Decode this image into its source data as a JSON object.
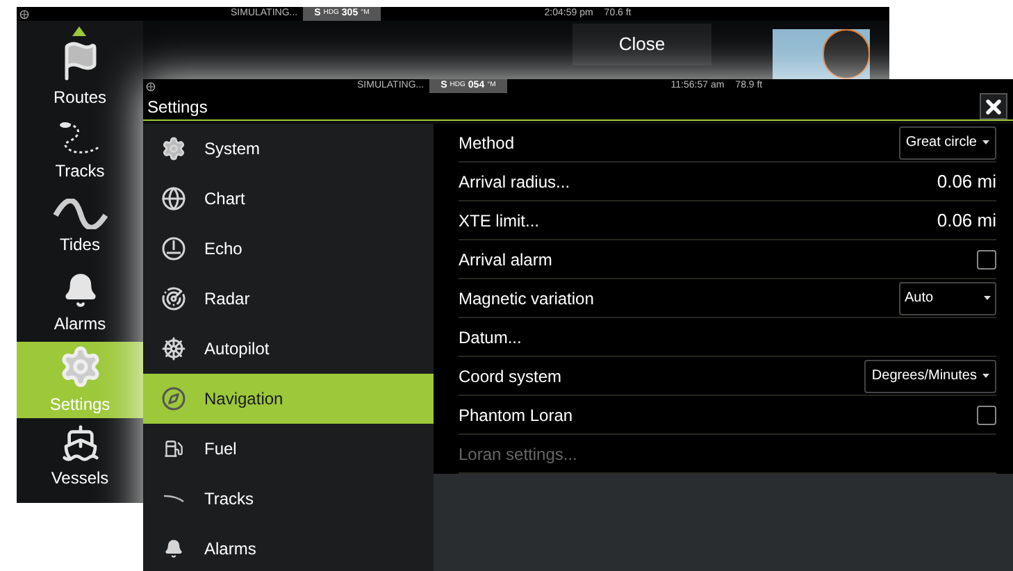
{
  "back_window": {
    "status_bar": {
      "status": "SIMULATING...",
      "heading": [
        "S",
        "HDG",
        "305",
        "°M"
      ],
      "time": "2:04:59 pm",
      "depth": "70.6 ft"
    },
    "close_button": "Close",
    "sidebar": [
      {
        "label": "Routes",
        "selected": false
      },
      {
        "label": "Tracks",
        "selected": false
      },
      {
        "label": "Tides",
        "selected": false
      },
      {
        "label": "Alarms",
        "selected": false
      },
      {
        "label": "Settings",
        "selected": true
      },
      {
        "label": "Vessels",
        "selected": false
      }
    ]
  },
  "settings_window": {
    "status_bar": {
      "status": "SIMULATING...",
      "heading": [
        "S",
        "HDG",
        "054",
        "°M"
      ],
      "time": "11:56:57 am",
      "depth": "78.9 ft"
    },
    "title": "Settings",
    "categories": [
      {
        "label": "System",
        "selected": false
      },
      {
        "label": "Chart",
        "selected": false
      },
      {
        "label": "Echo",
        "selected": false
      },
      {
        "label": "Radar",
        "selected": false
      },
      {
        "label": "Autopilot",
        "selected": false
      },
      {
        "label": "Navigation",
        "selected": true
      },
      {
        "label": "Fuel",
        "selected": false
      },
      {
        "label": "Tracks",
        "selected": false
      },
      {
        "label": "Alarms",
        "selected": false
      }
    ],
    "options": [
      {
        "kind": "dropdown",
        "label": "Method",
        "value": "Great circle"
      },
      {
        "kind": "value",
        "label": "Arrival radius...",
        "value": "0.06 mi"
      },
      {
        "kind": "value",
        "label": "XTE limit...",
        "value": "0.06 mi"
      },
      {
        "kind": "checkbox",
        "label": "Arrival alarm",
        "checked": false
      },
      {
        "kind": "wide-dropdown",
        "label": "Magnetic variation",
        "value": "Auto"
      },
      {
        "kind": "plain",
        "label": "Datum..."
      },
      {
        "kind": "dropdown",
        "label": "Coord system",
        "value": "Degrees/Minutes"
      },
      {
        "kind": "checkbox",
        "label": "Phantom Loran",
        "checked": false
      },
      {
        "kind": "disabled",
        "label": "Loran settings..."
      }
    ]
  }
}
